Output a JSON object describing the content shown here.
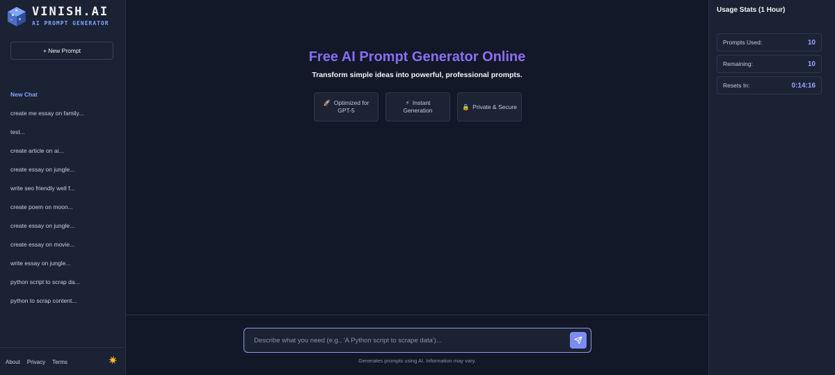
{
  "brand": {
    "title": "VINISH.AI",
    "subtitle": "AI PROMPT GENERATOR"
  },
  "sidebar": {
    "new_prompt_label": "+ New Prompt",
    "history": [
      {
        "label": "New Chat",
        "active": true
      },
      {
        "label": "create me essay on family..."
      },
      {
        "label": "test..."
      },
      {
        "label": "create article on ai..."
      },
      {
        "label": "create essay on jungle..."
      },
      {
        "label": "write seo friendly well f..."
      },
      {
        "label": "create poem on moon..."
      },
      {
        "label": "create essay on jungle..."
      },
      {
        "label": "create essay on movie..."
      },
      {
        "label": "write essay on jungle..."
      },
      {
        "label": "python script to scrap da..."
      },
      {
        "label": "python to scrap content..."
      }
    ],
    "footer": {
      "about": "About",
      "privacy": "Privacy",
      "terms": "Terms",
      "theme_icon": "sun-icon"
    }
  },
  "main": {
    "title": "Free AI Prompt Generator Online",
    "subtitle": "Transform simple ideas into powerful, professional prompts.",
    "features": [
      {
        "icon": "🚀",
        "text": "Optimized for GPT-5"
      },
      {
        "icon": "⚡",
        "text": "Instant Generation"
      },
      {
        "icon": "🔒",
        "text": "Private & Secure"
      }
    ],
    "input": {
      "placeholder": "Describe what you need (e.g., 'A Python script to scrape data')...",
      "value": ""
    },
    "disclaimer": "Generates prompts using AI. Information may vary."
  },
  "stats": {
    "title": "Usage Stats (1 Hour)",
    "prompts_used_label": "Prompts Used:",
    "prompts_used_value": "10",
    "remaining_label": "Remaining:",
    "remaining_value": "10",
    "resets_label": "Resets In:",
    "resets_value": "0:14:16"
  },
  "colors": {
    "accent": "#7d8cf2",
    "title_gradient_start": "#7f6cf5",
    "title_gradient_end": "#9b6ff2",
    "background": "#121828",
    "panel": "#1b2233"
  }
}
